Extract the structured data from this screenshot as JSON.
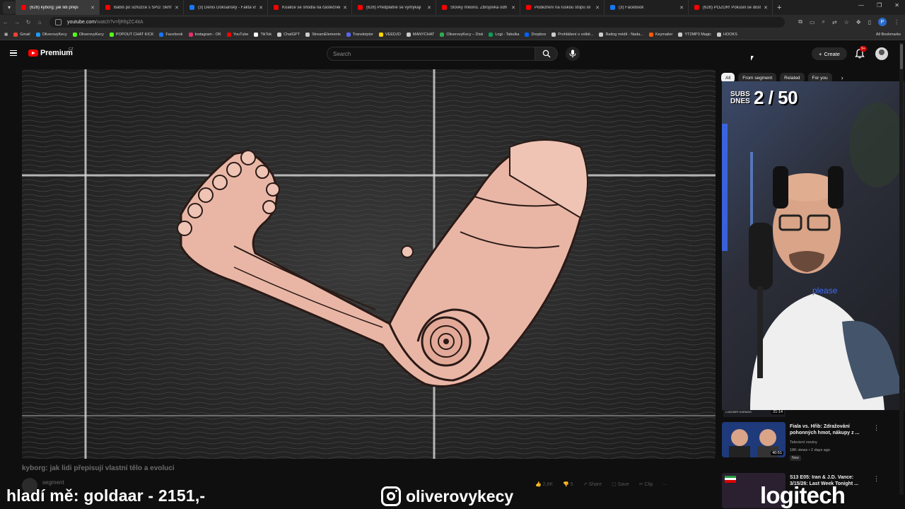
{
  "browser": {
    "tabs": [
      {
        "title": "(628) kyborg: jak lidi přepi",
        "color": "#ff0000",
        "active": true
      },
      {
        "title": "Babiš po schůzce s SPD: Škrtne",
        "color": "#ff0000"
      },
      {
        "title": "(3) Denis Doksanský - Fakta vs",
        "color": "#1877f2"
      },
      {
        "title": "Koalice se shodla na částečném",
        "color": "#ff0000"
      },
      {
        "title": "(628) Předplatné se vymýkají",
        "color": "#ff0000"
      },
      {
        "title": "Stovky milionů. Zbrojovka odh",
        "color": "#ff0000"
      },
      {
        "title": "Podezření na ruskou stopu slí",
        "color": "#ff0000"
      },
      {
        "title": "(3) Facebook",
        "color": "#1877f2"
      },
      {
        "title": "(628) POZOR! Pokusili se dosta",
        "color": "#ff0000"
      }
    ],
    "new_tab": "+",
    "window_controls": [
      "—",
      "❐",
      "✕"
    ],
    "url_host": "youtube.com",
    "url_path": "/watch?v=fjRfqZC4itA",
    "profile_initial": "P",
    "bookmarks": [
      {
        "label": "Gmail",
        "color": "#ea4335"
      },
      {
        "label": "OliverovyKecy",
        "color": "#1d9bf0"
      },
      {
        "label": "OliverovyKecy",
        "color": "#53fc18"
      },
      {
        "label": "POPOUT CHAT KICK",
        "color": "#53fc18"
      },
      {
        "label": "Facebook",
        "color": "#1877f2"
      },
      {
        "label": "Instagram - OK",
        "color": "#e1306c"
      },
      {
        "label": "YouTube",
        "color": "#ff0000"
      },
      {
        "label": "TikTok",
        "color": "#ffffff"
      },
      {
        "label": "ChatGPT",
        "color": "#cccccc"
      },
      {
        "label": "StreamElements",
        "color": "#cccccc"
      },
      {
        "label": "Transkriptor",
        "color": "#5865f2"
      },
      {
        "label": "VEEDJO",
        "color": "#ffd400"
      },
      {
        "label": "MANYCHAT",
        "color": "#cccccc"
      },
      {
        "label": "OliverovyKecy – Disk",
        "color": "#34a853"
      },
      {
        "label": "Logi - Tabulka",
        "color": "#0f9d58"
      },
      {
        "label": "Dropbox",
        "color": "#0061ff"
      },
      {
        "label": "Prohlášení o volbě...",
        "color": "#cccccc"
      },
      {
        "label": "Rating médií - Nada...",
        "color": "#cccccc"
      },
      {
        "label": "Keymailer",
        "color": "#ff5a00"
      },
      {
        "label": "YT2MP3 Magic",
        "color": "#cccccc"
      },
      {
        "label": "HOOKS",
        "color": "#cccccc"
      }
    ],
    "bookmarks_all": "All Bookmarks"
  },
  "youtube": {
    "logo": "Premium",
    "logo_cc": "CZ",
    "search_placeholder": "Search",
    "create_label": "Create",
    "notification_count": "9+",
    "video_title": "kyborg: jak lidi přepisují vlastní tělo a evoluci",
    "channel_name": "segment",
    "likes": "2,6K",
    "dislikes": "5",
    "share": "Share",
    "save": "Save",
    "clip": "Clip",
    "more": "...",
    "chips": [
      {
        "label": "All",
        "active": true
      },
      {
        "label": "From segment"
      },
      {
        "label": "Related"
      },
      {
        "label": "For you"
      }
    ],
    "chips_next": "›",
    "prev_rec": {
      "channel": "LUBOMÍR HARMAN",
      "duration": "21:14"
    },
    "recommendations": [
      {
        "title": "Fiala vs. Hřib: Zdražování pohonných hmot, nákupy z ...",
        "channel": "Televizní noviny",
        "meta": "18K views • 2 days ago",
        "duration": "40:51",
        "badge": "New",
        "thumb_color": "#1f3a7a"
      },
      {
        "title": "S13 E05: Iran & J.D. Vance: 3/15/26: Last Week Tonight ...",
        "channel": "",
        "meta": "",
        "duration": "",
        "badge": "",
        "thumb_color": "#2a2030"
      }
    ]
  },
  "stream_overlay": {
    "subs_label": "SUBS DNES",
    "subs_value": "2 / 50",
    "left_text": "hladí mě: goldaar - 2151,-",
    "instagram_handle": "oliverovykecy",
    "brand": "logitech",
    "shirt_text": "please"
  }
}
